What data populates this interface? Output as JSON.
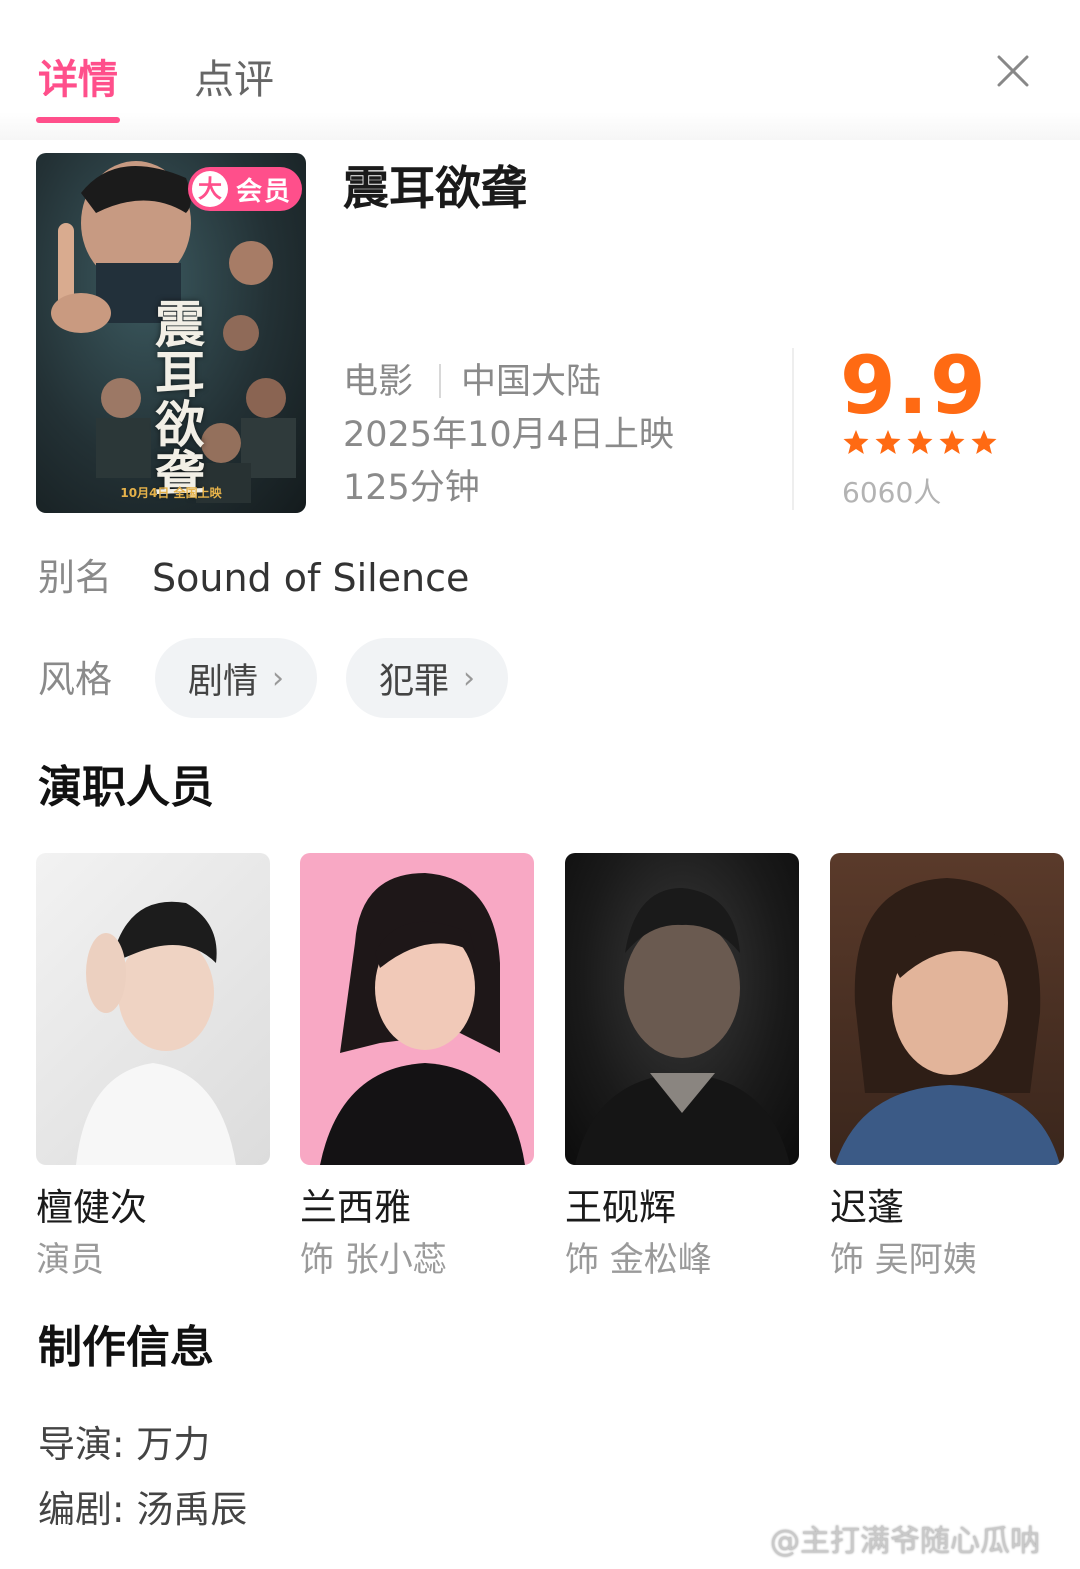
{
  "header": {
    "tabs": [
      {
        "label": "详情",
        "active": true
      },
      {
        "label": "点评",
        "active": false
      }
    ],
    "close_icon": "close-icon",
    "accent_color": "#ff4f8b"
  },
  "movie": {
    "poster": {
      "badge_big": "大",
      "badge_text": "会员",
      "title_text": "震耳欲聋",
      "date_text": "10月4日 全国上映"
    },
    "title": "震耳欲聋",
    "type": "电影",
    "region": "中国大陆",
    "release": "2025年10月4日上映",
    "duration": "125分钟",
    "score": "9.9",
    "star_rating": 5,
    "raters": "6060人",
    "score_color": "#ff6a13"
  },
  "alias": {
    "label": "别名",
    "value": "Sound of Silence"
  },
  "genre": {
    "label": "风格",
    "chips": [
      "剧情",
      "犯罪"
    ]
  },
  "cast": {
    "title": "演职人员",
    "members": [
      {
        "name": "檀健次",
        "role": "演员"
      },
      {
        "name": "兰西雅",
        "role": "饰 张小蕊"
      },
      {
        "name": "王砚辉",
        "role": "饰 金松峰"
      },
      {
        "name": "迟蓬",
        "role": "饰 吴阿姨"
      }
    ]
  },
  "production": {
    "title": "制作信息",
    "director": "导演: 万力",
    "writer": "编剧: 汤禹辰"
  },
  "watermark": "@主打满爷随心瓜呐"
}
